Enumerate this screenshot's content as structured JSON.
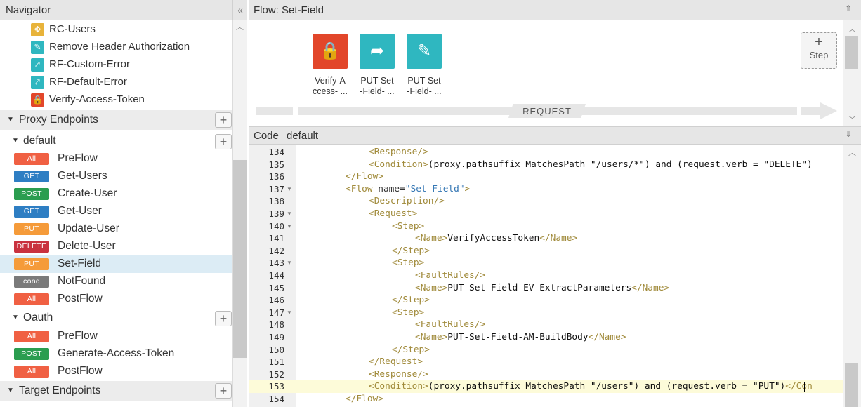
{
  "navigator": {
    "title": "Navigator",
    "collapse_glyph": "«",
    "policies": [
      {
        "label": "RC-Users",
        "icon": "response-cache-icon",
        "color": "#e8b33a",
        "glyph": "✥"
      },
      {
        "label": "Remove Header Authorization",
        "icon": "assign-message-icon",
        "color": "#2fb7c0",
        "glyph": "✎"
      },
      {
        "label": "RF-Custom-Error",
        "icon": "raise-fault-icon",
        "color": "#2fb7c0",
        "glyph": "⤤"
      },
      {
        "label": "RF-Default-Error",
        "icon": "raise-fault-icon",
        "color": "#2fb7c0",
        "glyph": "⤤"
      },
      {
        "label": "Verify-Access-Token",
        "icon": "lock-icon",
        "color": "#e2462a",
        "glyph": "🔒"
      }
    ],
    "proxy_endpoints_label": "Proxy Endpoints",
    "default_label": "default",
    "default_flows": [
      {
        "badge": "All",
        "badge_color": "#f06043",
        "label": "PreFlow"
      },
      {
        "badge": "GET",
        "badge_color": "#2e7ec3",
        "label": "Get-Users"
      },
      {
        "badge": "POST",
        "badge_color": "#2a9d4f",
        "label": "Create-User"
      },
      {
        "badge": "GET",
        "badge_color": "#2e7ec3",
        "label": "Get-User"
      },
      {
        "badge": "PUT",
        "badge_color": "#f59b3a",
        "label": "Update-User"
      },
      {
        "badge": "DELETE",
        "badge_color": "#c9323f",
        "label": "Delete-User"
      },
      {
        "badge": "PUT",
        "badge_color": "#f59b3a",
        "label": "Set-Field"
      },
      {
        "badge": "cond",
        "badge_color": "#7a7a7a",
        "label": "NotFound"
      },
      {
        "badge": "All",
        "badge_color": "#f06043",
        "label": "PostFlow"
      }
    ],
    "oauth_label": "Oauth",
    "oauth_flows": [
      {
        "badge": "All",
        "badge_color": "#f06043",
        "label": "PreFlow"
      },
      {
        "badge": "POST",
        "badge_color": "#2a9d4f",
        "label": "Generate-Access-Token"
      },
      {
        "badge": "All",
        "badge_color": "#f06043",
        "label": "PostFlow"
      }
    ],
    "target_endpoints_label": "Target Endpoints",
    "plus": "+"
  },
  "flow": {
    "title": "Flow: Set-Field",
    "collapse_glyph": "⇑",
    "steps": [
      {
        "line1": "Verify-A",
        "line2": "ccess- ...",
        "icon": "lock-icon",
        "color": "#e2462a",
        "glyph": "🔒"
      },
      {
        "line1": "PUT-Set",
        "line2": "-Field- ...",
        "icon": "share-icon",
        "color": "#2fb7c0",
        "glyph": "➦"
      },
      {
        "line1": "PUT-Set",
        "line2": "-Field- ...",
        "icon": "pencil-icon",
        "color": "#2fb7c0",
        "glyph": "✎"
      }
    ],
    "add_step_plus": "+",
    "add_step_label": "Step",
    "request_label": "REQUEST"
  },
  "code": {
    "title": "Code",
    "subtitle": "default",
    "collapse_glyph": "⇓",
    "lines": [
      {
        "n": "134",
        "fold": false,
        "indent": 3,
        "html": "<span class='tag'>&lt;Response/&gt;</span>"
      },
      {
        "n": "135",
        "fold": false,
        "indent": 3,
        "html": "<span class='tag'>&lt;Condition&gt;</span>(proxy.pathsuffix MatchesPath \"/users/*\") and (request.verb = \"DELETE\")"
      },
      {
        "n": "136",
        "fold": false,
        "indent": 2,
        "html": "<span class='tag'>&lt;/Flow&gt;</span>"
      },
      {
        "n": "137",
        "fold": true,
        "indent": 2,
        "html": "<span class='tag'>&lt;Flow</span> <span class='attr'>name=</span><span class='str'>\"Set-Field\"</span><span class='tag'>&gt;</span>"
      },
      {
        "n": "138",
        "fold": false,
        "indent": 3,
        "html": "<span class='tag'>&lt;Description/&gt;</span>"
      },
      {
        "n": "139",
        "fold": true,
        "indent": 3,
        "html": "<span class='tag'>&lt;Request&gt;</span>"
      },
      {
        "n": "140",
        "fold": true,
        "indent": 4,
        "html": "<span class='tag'>&lt;Step&gt;</span>"
      },
      {
        "n": "141",
        "fold": false,
        "indent": 5,
        "html": "<span class='tag'>&lt;Name&gt;</span>VerifyAccessToken<span class='tag'>&lt;/Name&gt;</span>"
      },
      {
        "n": "142",
        "fold": false,
        "indent": 4,
        "html": "<span class='tag'>&lt;/Step&gt;</span>"
      },
      {
        "n": "143",
        "fold": true,
        "indent": 4,
        "html": "<span class='tag'>&lt;Step&gt;</span>"
      },
      {
        "n": "144",
        "fold": false,
        "indent": 5,
        "html": "<span class='tag'>&lt;FaultRules/&gt;</span>"
      },
      {
        "n": "145",
        "fold": false,
        "indent": 5,
        "html": "<span class='tag'>&lt;Name&gt;</span>PUT-Set-Field-EV-ExtractParameters<span class='tag'>&lt;/Name&gt;</span>"
      },
      {
        "n": "146",
        "fold": false,
        "indent": 4,
        "html": "<span class='tag'>&lt;/Step&gt;</span>"
      },
      {
        "n": "147",
        "fold": true,
        "indent": 4,
        "html": "<span class='tag'>&lt;Step&gt;</span>"
      },
      {
        "n": "148",
        "fold": false,
        "indent": 5,
        "html": "<span class='tag'>&lt;FaultRules/&gt;</span>"
      },
      {
        "n": "149",
        "fold": false,
        "indent": 5,
        "html": "<span class='tag'>&lt;Name&gt;</span>PUT-Set-Field-AM-BuildBody<span class='tag'>&lt;/Name&gt;</span>"
      },
      {
        "n": "150",
        "fold": false,
        "indent": 4,
        "html": "<span class='tag'>&lt;/Step&gt;</span>"
      },
      {
        "n": "151",
        "fold": false,
        "indent": 3,
        "html": "<span class='tag'>&lt;/Request&gt;</span>"
      },
      {
        "n": "152",
        "fold": false,
        "indent": 3,
        "html": "<span class='tag'>&lt;Response/&gt;</span>"
      },
      {
        "n": "153",
        "fold": false,
        "indent": 3,
        "html": "<span class='tag'>&lt;Condition&gt;</span>(proxy.pathsuffix MatchesPath \"/users\") and (request.verb = \"PUT\")<span class='tag'>&lt;/Con</span>"
      },
      {
        "n": "154",
        "fold": false,
        "indent": 2,
        "html": "<span class='tag'>&lt;/Flow&gt;</span>"
      }
    ]
  }
}
